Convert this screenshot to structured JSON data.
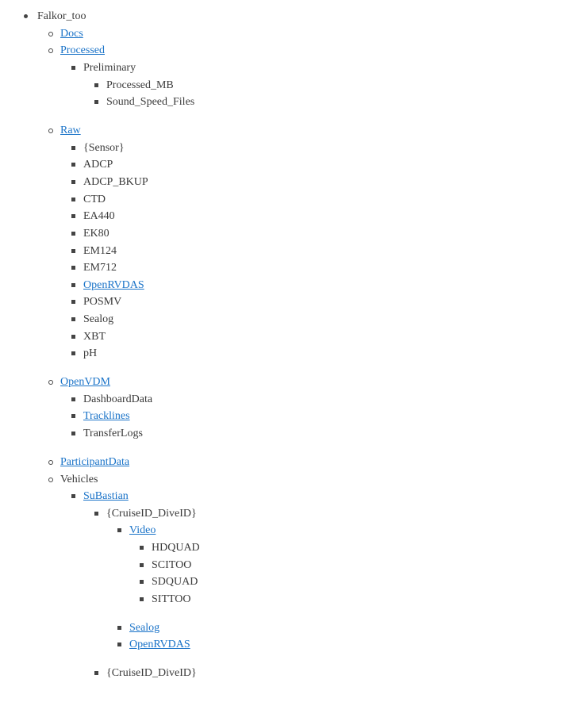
{
  "tree": {
    "root": "Falkor_too",
    "docs": "Docs",
    "processed": "Processed",
    "preliminary": "Preliminary",
    "processed_mb": "Processed_MB",
    "sound_speed_files": "Sound_Speed_Files",
    "raw": "Raw",
    "raw_items": [
      "{Sensor}",
      "ADCP",
      "ADCP_BKUP",
      "CTD",
      "EA440",
      "EK80",
      "EM124",
      "EM712",
      "OpenRVDAS",
      "POSMV",
      "Sealog",
      "XBT",
      "pH"
    ],
    "openvdm": "OpenVDM",
    "openvdm_items": [
      "DashboardData",
      "Tracklines",
      "TransferLogs"
    ],
    "participant_data": "ParticipantData",
    "vehicles": "Vehicles",
    "subastian": "SuBastian",
    "cruise_dive_1": "{CruiseID_DiveID}",
    "video": "Video",
    "video_items": [
      "HDQUAD",
      "SCITOO",
      "SDQUAD",
      "SITTOO"
    ],
    "sealog": "Sealog",
    "openrvdas": "OpenRVDAS",
    "cruise_dive_2": "{CruiseID_DiveID}"
  },
  "colors": {
    "link": "#1a73c8",
    "text": "#3a3a3a"
  }
}
